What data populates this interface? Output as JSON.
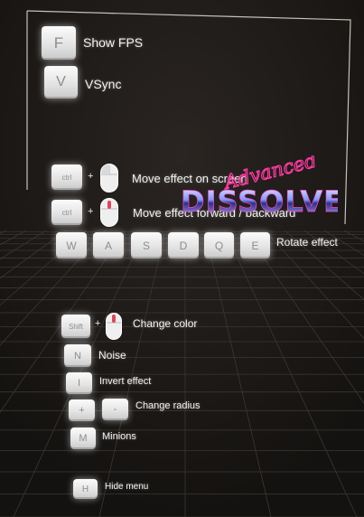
{
  "settings": {
    "fps": {
      "key": "F",
      "label": "Show FPS"
    },
    "vsync": {
      "key": "V",
      "label": "VSync"
    }
  },
  "controls": {
    "move_screen": {
      "key": "ctrl",
      "plus": "+",
      "label": "Move effect on screen"
    },
    "move_depth": {
      "key": "ctrl",
      "plus": "+",
      "label": "Move effect forward / backward"
    },
    "rotate": {
      "keys": [
        "W",
        "A",
        "S",
        "D",
        "Q",
        "E"
      ],
      "label": "Rotate effect"
    },
    "color": {
      "key": "Shift",
      "plus": "+",
      "label": "Change color"
    },
    "noise": {
      "key": "N",
      "label": "Noise"
    },
    "invert": {
      "key": "I",
      "label": "Invert effect"
    },
    "radius": {
      "keys": [
        "+",
        "-"
      ],
      "label": "Change radius"
    },
    "minions": {
      "key": "M",
      "label": "Minions"
    },
    "hide": {
      "key": "H",
      "label": "Hide menu"
    }
  },
  "logo": {
    "script": "Advanced",
    "title": "DISSOLVE"
  },
  "colors": {
    "background": "#1b1816",
    "grid": "#3a3632",
    "panel_outline": "#bdbab5",
    "logo_script": "#ff3aa0",
    "logo_title": "#9fb6ff"
  }
}
